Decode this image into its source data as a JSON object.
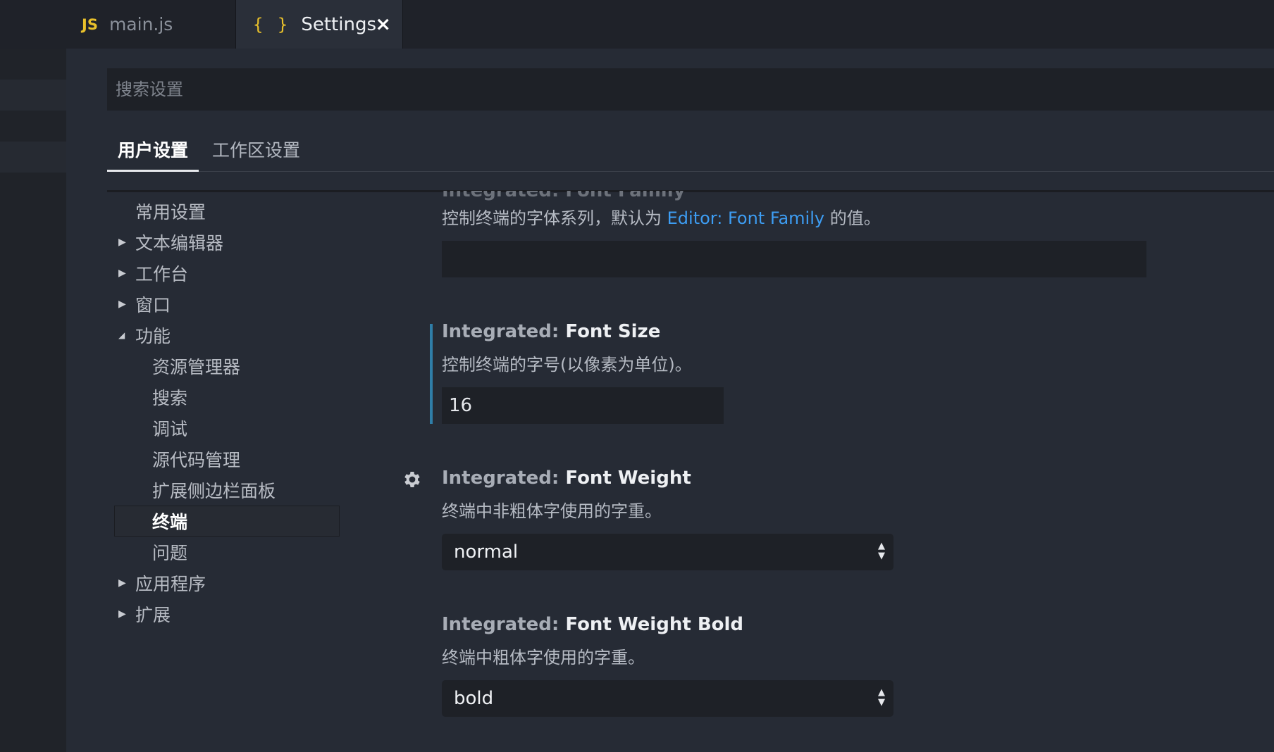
{
  "tabs": [
    {
      "icon": "JS",
      "label": "main.js",
      "active": false
    },
    {
      "icon": "{ }",
      "label": "Settings",
      "active": true,
      "close": "×"
    }
  ],
  "search": {
    "placeholder": "搜索设置"
  },
  "settings_tabs": [
    {
      "label": "用户设置",
      "active": true
    },
    {
      "label": "工作区设置",
      "active": false
    }
  ],
  "toc": [
    {
      "label": "常用设置",
      "arrow": ""
    },
    {
      "label": "文本编辑器",
      "arrow": "▶"
    },
    {
      "label": "工作台",
      "arrow": "▶"
    },
    {
      "label": "窗口",
      "arrow": "▶"
    },
    {
      "label": "功能",
      "arrow": "◢"
    },
    {
      "label": "资源管理器",
      "arrow": ""
    },
    {
      "label": "搜索",
      "arrow": ""
    },
    {
      "label": "调试",
      "arrow": ""
    },
    {
      "label": "源代码管理",
      "arrow": ""
    },
    {
      "label": "扩展侧边栏面板",
      "arrow": ""
    },
    {
      "label": "终端",
      "arrow": "",
      "selected": true
    },
    {
      "label": "问题",
      "arrow": ""
    },
    {
      "label": "应用程序",
      "arrow": "▶"
    },
    {
      "label": "扩展",
      "arrow": "▶"
    }
  ],
  "settings": {
    "font_family": {
      "title_partial": "Integrated: Font Family",
      "desc_before": "控制终端的字体系列，默认为 ",
      "desc_link": "Editor: Font Family",
      "desc_after": " 的值。",
      "value": ""
    },
    "font_size": {
      "category": "Integrated: ",
      "name": "Font Size",
      "desc": "控制终端的字号(以像素为单位)。",
      "value": "16"
    },
    "font_weight": {
      "category": "Integrated: ",
      "name": "Font Weight",
      "desc": "终端中非粗体字使用的字重。",
      "value": "normal"
    },
    "font_weight_bold": {
      "category": "Integrated: ",
      "name": "Font Weight Bold",
      "desc": "终端中粗体字使用的字重。",
      "value": "bold"
    }
  },
  "colors": {
    "accent": "#2f7ea8",
    "link": "#3d9df3",
    "js_icon": "#e8c02b"
  }
}
